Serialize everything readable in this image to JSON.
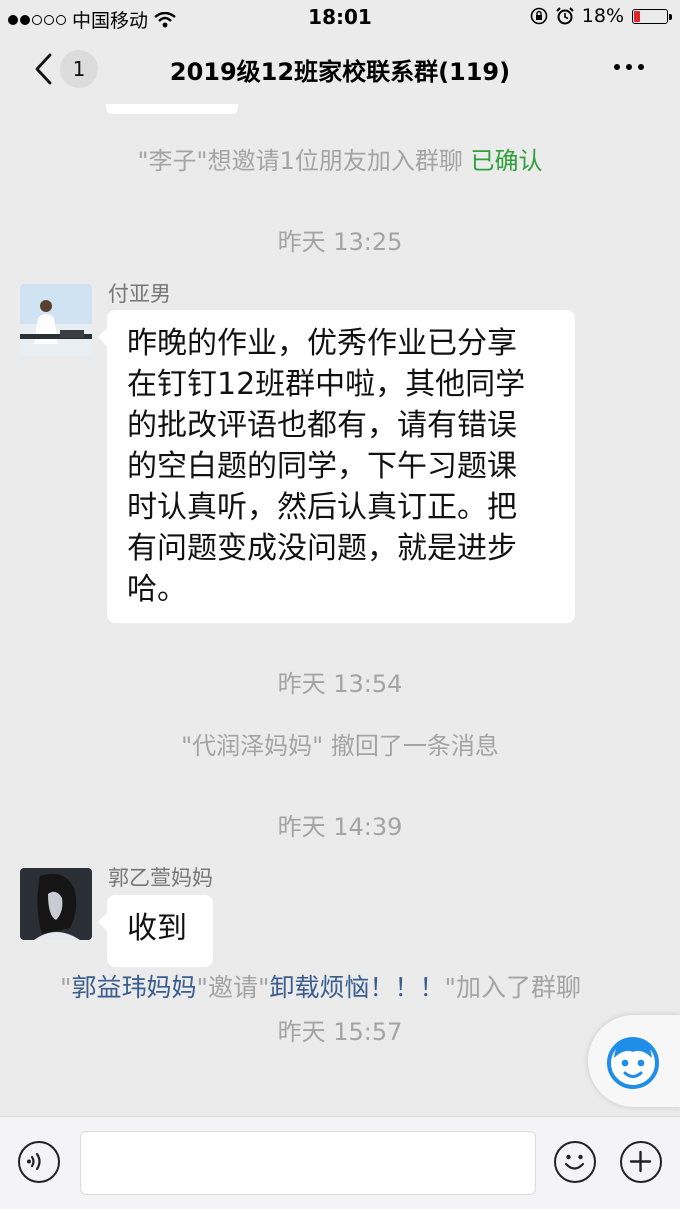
{
  "status_bar": {
    "carrier": "中国移动",
    "time": "18:01",
    "battery_text": "18%",
    "battery_level": 0.18,
    "colors": {
      "battery_low": "#e0262b"
    }
  },
  "nav": {
    "unread_count": "1",
    "title": "2019级12班家校联系群(119)"
  },
  "messages": {
    "invite_confirm": {
      "text": "\"李子\"想邀请1位朋友加入群聊",
      "status": "已确认"
    },
    "time1": "昨天 13:25",
    "msg1": {
      "sender": "付亚男",
      "lines": [
        "昨晚的作业，优秀作业已分享",
        "在钉钉12班群中啦，其他同学",
        "的批改评语也都有，请有错误",
        "的空白题的同学，下午习题课",
        "时认真听，然后认真订正。把",
        "有问题变成没问题，就是进步",
        "哈。"
      ]
    },
    "time2": "昨天 13:54",
    "recall": "\"代润泽妈妈\" 撤回了一条消息",
    "time3": "昨天 14:39",
    "msg2": {
      "sender": "郭乙萱妈妈",
      "text": "收到"
    },
    "time4": "昨天 15:57",
    "invite_join": {
      "q1": "\"",
      "inviter": "郭益玮妈妈",
      "mid": "\"邀请\"",
      "invitee": "卸载烦恼！！！",
      "tail": "\"加入了群聊"
    }
  },
  "colors": {
    "green": "#2fa13b",
    "link_blue": "#3a5d8f",
    "chat_bg": "#ebebeb"
  },
  "icons": [
    "back-chevron-icon",
    "more-icon",
    "robot-face-icon",
    "voice-icon",
    "emoji-icon",
    "plus-icon"
  ]
}
